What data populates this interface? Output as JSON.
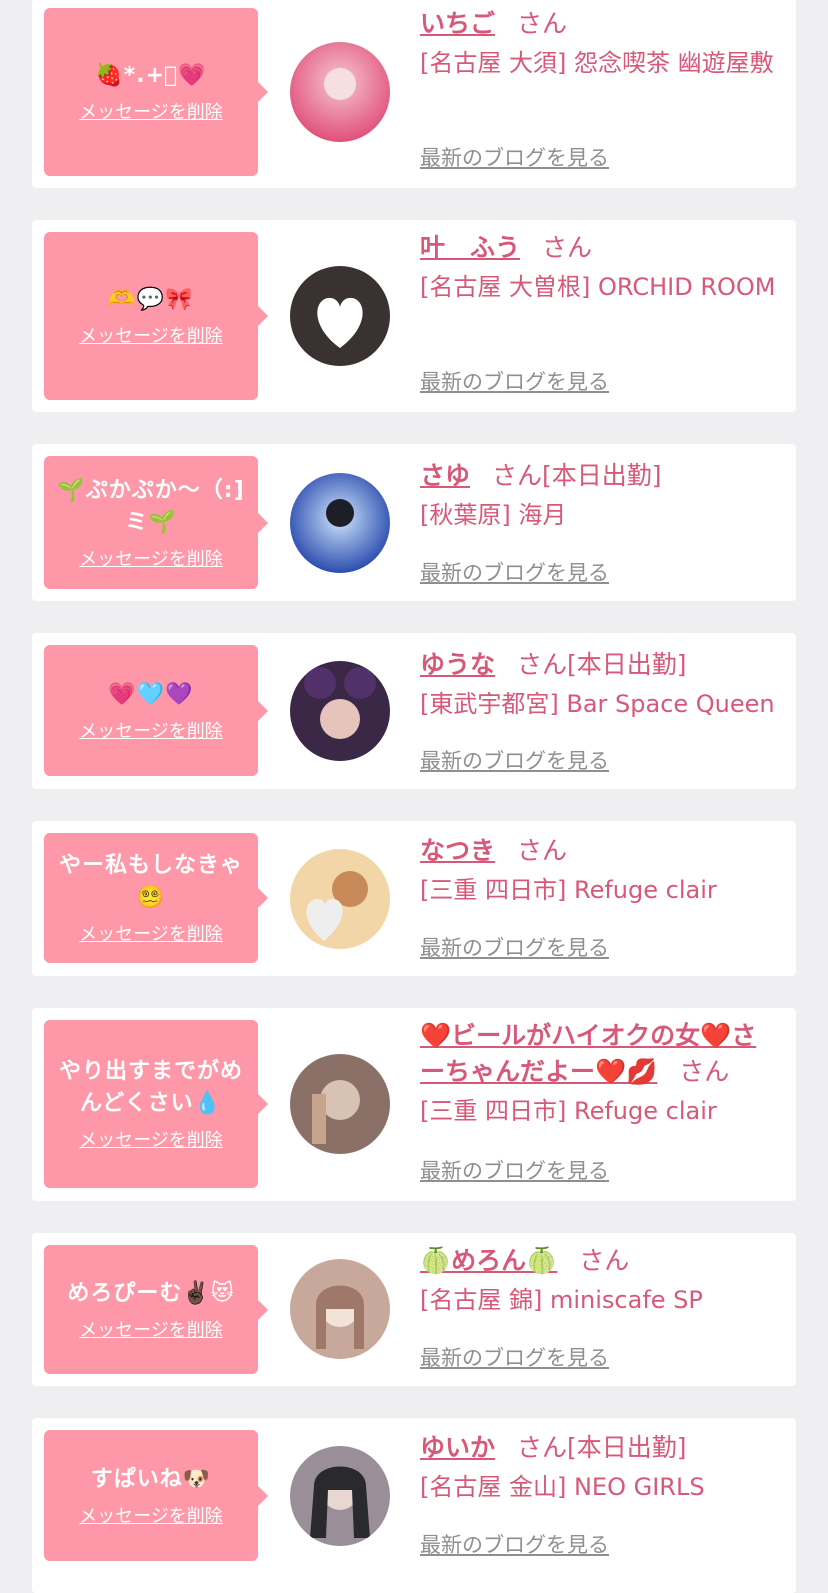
{
  "messages": [
    {
      "bubble_text": "🍓*.+ﾟ💗",
      "delete_label": "メッセージを削除",
      "name": "いちご",
      "honorific": "さん",
      "status": "",
      "shop": "[名古屋 大須] 怨念喫茶 幽遊屋敷",
      "blog_label": "最新のブログを見る",
      "avatar_colors": [
        "#e0507a",
        "#f6c7d2"
      ]
    },
    {
      "bubble_text": "🫶💬🎀",
      "delete_label": "メッセージを削除",
      "name": "叶　ふう",
      "honorific": "さん",
      "status": "",
      "shop": "[名古屋 大曽根] ORCHID ROOM",
      "blog_label": "最新のブログを見る",
      "avatar_colors": [
        "#2a2524",
        "#6b5e5a"
      ]
    },
    {
      "bubble_text": "🌱ぷかぷか〜（:]ミ🌱",
      "delete_label": "メッセージを削除",
      "name": "さゆ",
      "honorific": "さん",
      "status": "[本日出勤]",
      "shop": "[秋葉原] 海月",
      "blog_label": "最新のブログを見る",
      "avatar_colors": [
        "#1d3fa8",
        "#6fb6ef"
      ]
    },
    {
      "bubble_text": "💗🩵💜",
      "delete_label": "メッセージを削除",
      "name": "ゆうな",
      "honorific": "さん",
      "status": "[本日出勤]",
      "shop": "[東武宇都宮] Bar Space Queen",
      "blog_label": "最新のブログを見る",
      "avatar_colors": [
        "#3a2846",
        "#c99a9a"
      ]
    },
    {
      "bubble_text": "やー私もしなきゃ😵‍💫",
      "delete_label": "メッセージを削除",
      "name": "なつき",
      "honorific": "さん",
      "status": "",
      "shop": "[三重 四日市] Refuge clair",
      "blog_label": "最新のブログを見る",
      "avatar_colors": [
        "#f2d6a8",
        "#c98a5a"
      ]
    },
    {
      "bubble_text": "やり出すまでがめんどくさい💧",
      "delete_label": "メッセージを削除",
      "name": "❤️ビールがハイオクの女❤️さーちゃんだよー❤️💋",
      "honorific": "さん",
      "status": "",
      "shop": "[三重 四日市] Refuge clair",
      "blog_label": "最新のブログを見る",
      "avatar_colors": [
        "#8a7066",
        "#d8c2b4"
      ]
    },
    {
      "bubble_text": "めろぴーむ✌🏿😻",
      "delete_label": "メッセージを削除",
      "name": "🍈めろん🍈",
      "honorific": "さん",
      "status": "",
      "shop": "[名古屋 錦] miniscafe SP",
      "blog_label": "最新のブログを見る",
      "avatar_colors": [
        "#c8a89a",
        "#f2e2d8"
      ]
    },
    {
      "bubble_text": "すぱいね🐶",
      "delete_label": "メッセージを削除",
      "name": "ゆいか",
      "honorific": "さん",
      "status": "[本日出勤]",
      "shop": "[名古屋 金山] NEO GIRLS",
      "blog_label": "最新のブログを見る",
      "avatar_colors": [
        "#2a2a2e",
        "#9a8f98"
      ]
    }
  ]
}
